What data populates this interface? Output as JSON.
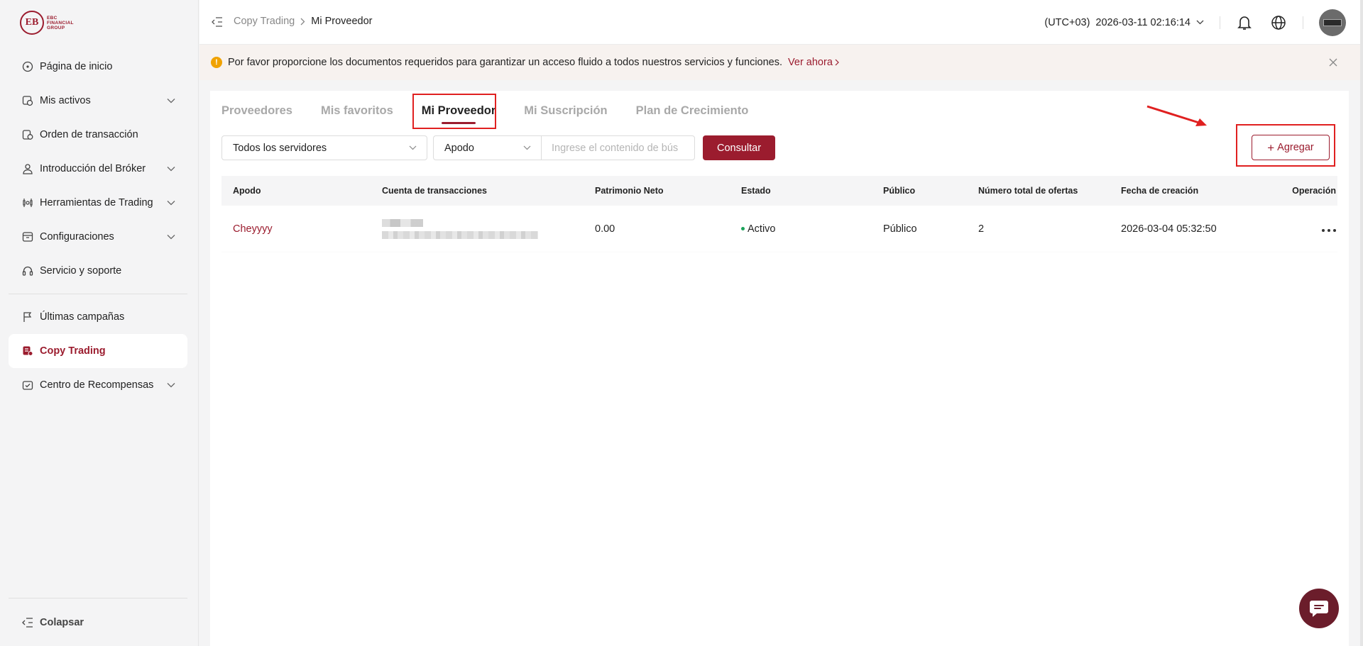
{
  "brand": {
    "logo_text_line1": "EBC",
    "logo_text_line2": "FINANCIAL",
    "logo_text_line3": "GROUP",
    "logo_mark": "EB",
    "accent_color": "#9b1c2e"
  },
  "sidebar": {
    "items": [
      {
        "label": "Página de inicio",
        "icon": "home-icon"
      },
      {
        "label": "Mis activos",
        "icon": "wallet-icon",
        "expandable": true
      },
      {
        "label": "Orden de transacción",
        "icon": "order-icon"
      },
      {
        "label": "Introducción del Bróker",
        "icon": "user-icon",
        "expandable": true
      },
      {
        "label": "Herramientas de Trading",
        "icon": "tools-icon",
        "expandable": true
      },
      {
        "label": "Configuraciones",
        "icon": "settings-icon",
        "expandable": true
      },
      {
        "label": "Servicio y soporte",
        "icon": "headset-icon"
      },
      {
        "label": "Últimas campañas",
        "icon": "flag-icon"
      },
      {
        "label": "Copy Trading",
        "icon": "copy-trading-icon",
        "active": true
      },
      {
        "label": "Centro de Recompensas",
        "icon": "reward-icon",
        "expandable": true
      }
    ],
    "collapse_label": "Colapsar"
  },
  "header": {
    "breadcrumb": {
      "parent": "Copy Trading",
      "current": "Mi Proveedor"
    },
    "timezone": "(UTC+03)",
    "datetime": "2026-03-11 02:16:14"
  },
  "notice": {
    "text": "Por favor proporcione los documentos requeridos para garantizar un acceso fluido a todos nuestros servicios y funciones.",
    "link": "Ver ahora"
  },
  "tabs": [
    {
      "label": "Proveedores"
    },
    {
      "label": "Mis favoritos"
    },
    {
      "label": "Mi Proveedor",
      "active": true
    },
    {
      "label": "Mi Suscripción"
    },
    {
      "label": "Plan de Crecimiento"
    }
  ],
  "filters": {
    "server_select": "Todos los servidores",
    "field_select": "Apodo",
    "search_placeholder": "Ingrese el contenido de bús",
    "query_button": "Consultar",
    "add_button": "Agregar"
  },
  "table": {
    "headers": [
      "Apodo",
      "Cuenta de transacciones",
      "Patrimonio Neto",
      "Estado",
      "Público",
      "Número total de ofertas",
      "Fecha de creación",
      "Operación"
    ],
    "rows": [
      {
        "nickname": "Cheyyyy",
        "equity": "0.00",
        "status": "Activo",
        "public": "Público",
        "offers": "2",
        "created": "2026-03-04 05:32:50"
      }
    ]
  }
}
